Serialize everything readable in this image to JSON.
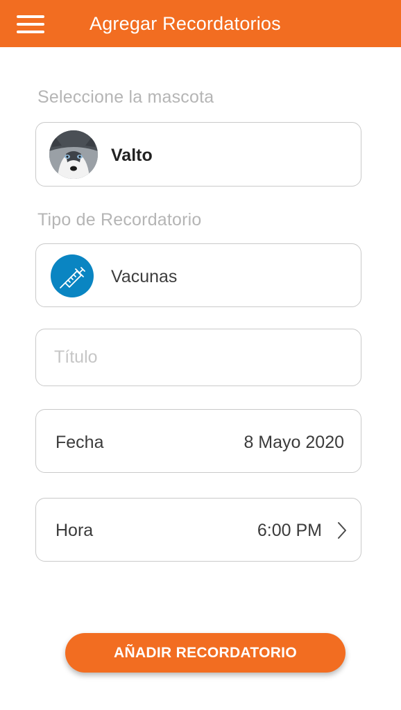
{
  "header": {
    "title": "Agregar Recordatorios",
    "accent_color": "#f26d21"
  },
  "pet_section": {
    "label": "Seleccione la mascota",
    "selected_pet": "Valto",
    "avatar_icon": "husky-dog-avatar"
  },
  "type_section": {
    "label": "Tipo de Recordatorio",
    "selected_type": "Vacunas",
    "type_icon": "syringe-icon",
    "icon_color": "#0a85c2"
  },
  "title_field": {
    "placeholder": "Título",
    "value": ""
  },
  "date_field": {
    "label": "Fecha",
    "value": "8 Mayo 2020"
  },
  "time_field": {
    "label": "Hora",
    "value": "6:00 PM"
  },
  "actions": {
    "add_label": "AÑADIR RECORDATORIO"
  }
}
